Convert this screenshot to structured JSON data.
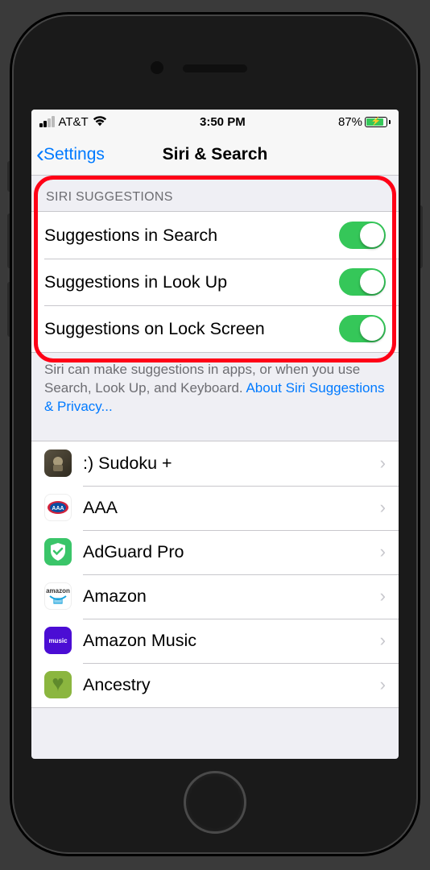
{
  "status": {
    "carrier": "AT&T",
    "time": "3:50 PM",
    "battery_percent": "87%"
  },
  "nav": {
    "back_label": "Settings",
    "title": "Siri & Search"
  },
  "siri_section": {
    "header": "SIRI SUGGESTIONS",
    "rows": [
      {
        "label": "Suggestions in Search",
        "on": true
      },
      {
        "label": "Suggestions in Look Up",
        "on": true
      },
      {
        "label": "Suggestions on Lock Screen",
        "on": true
      }
    ],
    "footer_text": "Siri can make suggestions in apps, or when you use Search, Look Up, and Keyboard.",
    "footer_link": "About Siri Suggestions & Privacy..."
  },
  "apps": [
    {
      "name": ":) Sudoku +",
      "icon": "sudoku"
    },
    {
      "name": "AAA",
      "icon": "aaa"
    },
    {
      "name": "AdGuard Pro",
      "icon": "adguard"
    },
    {
      "name": "Amazon",
      "icon": "amazon"
    },
    {
      "name": "Amazon Music",
      "icon": "amazonmusic"
    },
    {
      "name": "Ancestry",
      "icon": "ancestry"
    }
  ]
}
